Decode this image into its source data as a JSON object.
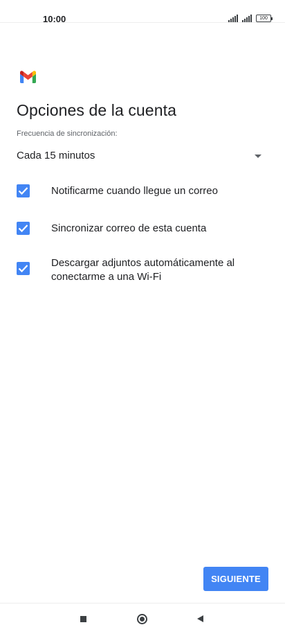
{
  "status_bar": {
    "time": "10:00",
    "battery": "100"
  },
  "app": {
    "logo_icon": "gmail-logo-icon",
    "brand_colors": {
      "red": "#EA4335",
      "blue": "#4285F4",
      "green": "#34A853",
      "yellow": "#FBBC04"
    }
  },
  "page": {
    "title": "Opciones de la cuenta"
  },
  "sync": {
    "label": "Frecuencia de sincronización:",
    "value": "Cada 15 minutos",
    "dropdown_icon": "chevron-down-icon"
  },
  "options": [
    {
      "label": "Notificarme cuando llegue un correo",
      "checked": true
    },
    {
      "label": "Sincronizar correo de esta cuenta",
      "checked": true
    },
    {
      "label": "Descargar adjuntos automáticamente al conectarme a una Wi-Fi",
      "checked": true
    }
  ],
  "actions": {
    "next_label": "SIGUIENTE",
    "accent_color": "#4285F4"
  },
  "nav": {
    "recent_icon": "recent-apps-icon",
    "home_icon": "home-icon",
    "back_icon": "back-icon"
  }
}
